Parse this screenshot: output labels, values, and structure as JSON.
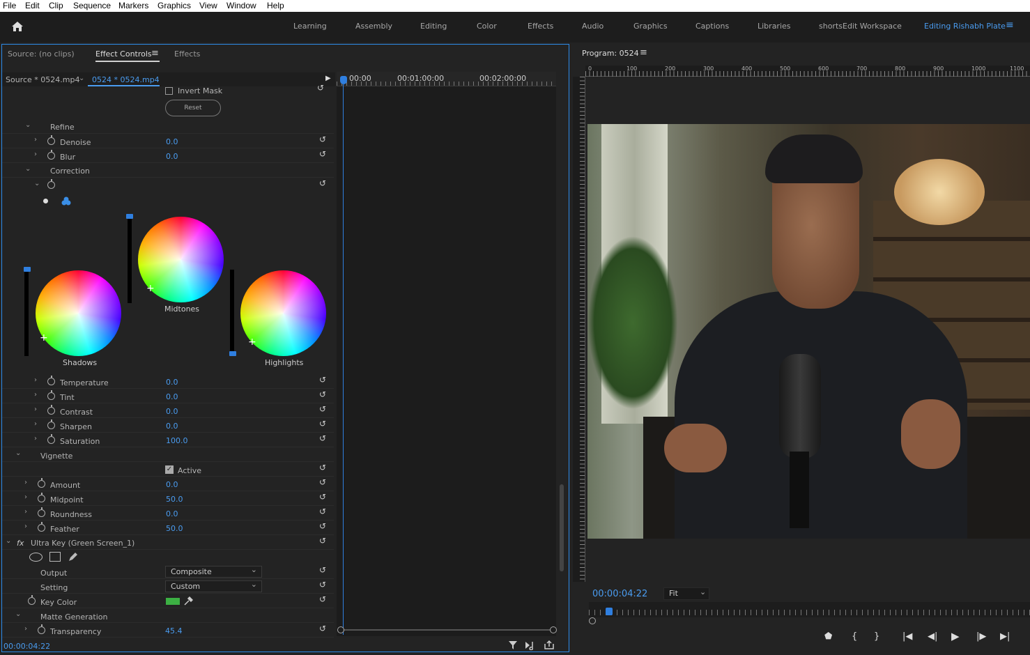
{
  "menu": [
    "File",
    "Edit",
    "Clip",
    "Sequence",
    "Markers",
    "Graphics",
    "View",
    "Window",
    "Help"
  ],
  "workspaces": [
    "Learning",
    "Assembly",
    "Editing",
    "Color",
    "Effects",
    "Audio",
    "Graphics",
    "Captions",
    "Libraries",
    "shortsEdit Workspace",
    "Editing Rishabh Plate"
  ],
  "active_workspace": "Editing Rishabh Plate",
  "panel_tabs": {
    "source": "Source: (no clips)",
    "effect_controls": "Effect Controls",
    "effects": "Effects"
  },
  "clip_header": {
    "source": "Source * 0524.mp4",
    "sequence": "0524 * 0524.mp4"
  },
  "timeline": {
    "t0": "00:00",
    "t1": "00:01:00:00",
    "t2": "00:02:00:00"
  },
  "mask": {
    "invert_label": "Invert Mask",
    "reset_label": "Reset"
  },
  "sections": {
    "refine": "Refine",
    "correction": "Correction",
    "vignette": "Vignette",
    "matte": "Matte Generation"
  },
  "refine": [
    {
      "label": "Denoise",
      "value": "0.0"
    },
    {
      "label": "Blur",
      "value": "0.0"
    }
  ],
  "wheels": {
    "shadows": "Shadows",
    "midtones": "Midtones",
    "highlights": "Highlights"
  },
  "correction": [
    {
      "label": "Temperature",
      "value": "0.0"
    },
    {
      "label": "Tint",
      "value": "0.0"
    },
    {
      "label": "Contrast",
      "value": "0.0"
    },
    {
      "label": "Sharpen",
      "value": "0.0"
    },
    {
      "label": "Saturation",
      "value": "100.0"
    }
  ],
  "vignette_active": "Active",
  "vignette": [
    {
      "label": "Amount",
      "value": "0.0"
    },
    {
      "label": "Midpoint",
      "value": "50.0"
    },
    {
      "label": "Roundness",
      "value": "0.0"
    },
    {
      "label": "Feather",
      "value": "50.0"
    }
  ],
  "ultrakey": {
    "title": "Ultra Key (Green Screen_1)",
    "fx": "fx",
    "output_label": "Output",
    "output_value": "Composite",
    "setting_label": "Setting",
    "setting_value": "Custom",
    "keycolor_label": "Key Color",
    "key_color": "#3cb043",
    "transparency_label": "Transparency",
    "transparency_value": "45.4"
  },
  "footer_timecode": "00:00:04:22",
  "program": {
    "title": "Program: 0524",
    "timecode": "00:00:04:22",
    "fit": "Fit",
    "ruler": [
      "0",
      "100",
      "200",
      "300",
      "400",
      "500",
      "600",
      "700",
      "800",
      "900",
      "1000",
      "1100"
    ]
  }
}
